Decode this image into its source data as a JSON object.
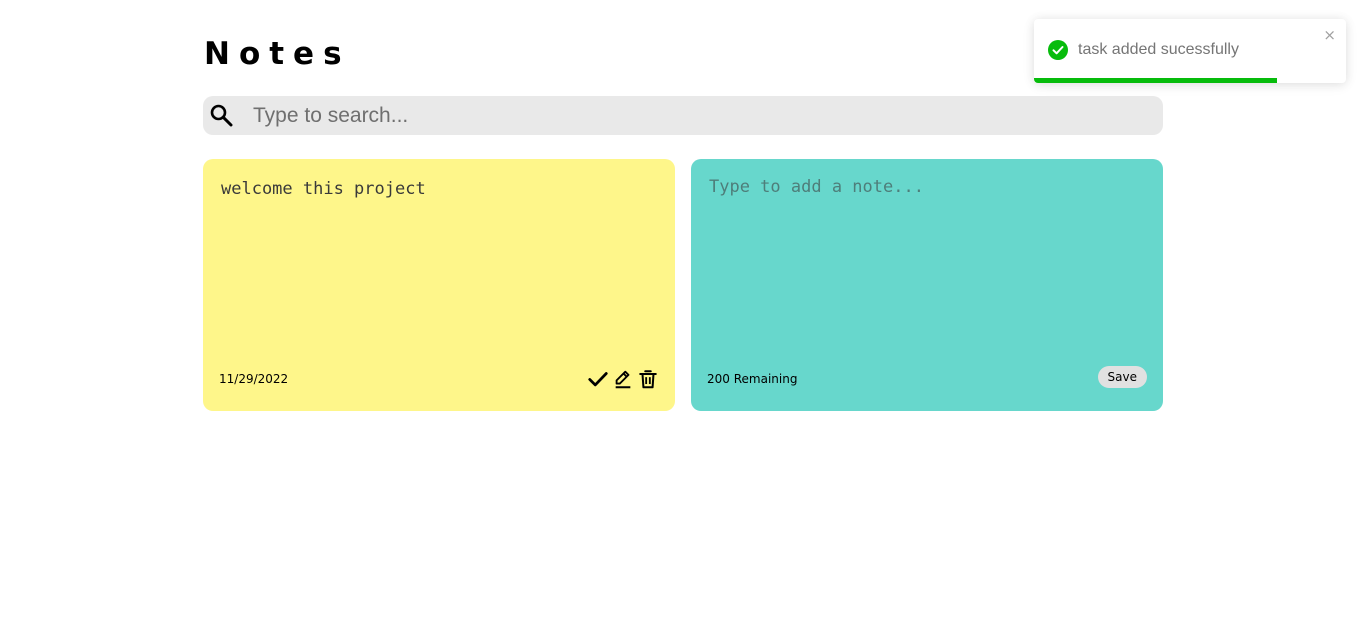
{
  "header": {
    "title": "Notes"
  },
  "search": {
    "placeholder": "Type to search...",
    "value": ""
  },
  "notes": [
    {
      "text": "welcome this project",
      "date": "11/29/2022",
      "color": "#fef68a"
    }
  ],
  "new_note": {
    "placeholder": "Type to add a note...",
    "remaining": "200 Remaining",
    "save_label": "Save",
    "color": "#67d7cc"
  },
  "toast": {
    "message": "task added sucessfully",
    "close_label": "×",
    "progress": 0.78,
    "accent": "#07bc0c"
  },
  "icons": [
    "search-icon",
    "check-icon",
    "edit-icon",
    "trash-icon",
    "success-check-icon",
    "close-icon"
  ]
}
